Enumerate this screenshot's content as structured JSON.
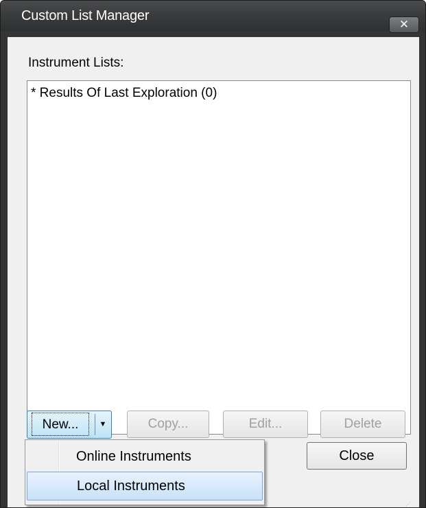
{
  "window": {
    "title": "Custom List Manager",
    "close_glyph": "✕"
  },
  "main": {
    "list_label": "Instrument Lists:",
    "list_items": [
      "* Results Of Last Exploration (0)"
    ]
  },
  "buttons": {
    "new_label": "New...",
    "new_arrow": "▼",
    "copy_label": "Copy...",
    "edit_label": "Edit...",
    "delete_label": "Delete",
    "close_label": "Close"
  },
  "menu": {
    "items": [
      {
        "label": "Online Instruments"
      },
      {
        "label": "Local Instruments"
      }
    ]
  },
  "icons": {
    "close": "close-icon",
    "dropdown": "chevron-down-icon",
    "resize": "resize-grip-icon"
  },
  "colors": {
    "titlebar": "#3a3c3e",
    "accent_border": "#3c7fb1",
    "hover_background": "#c9e1f9"
  }
}
